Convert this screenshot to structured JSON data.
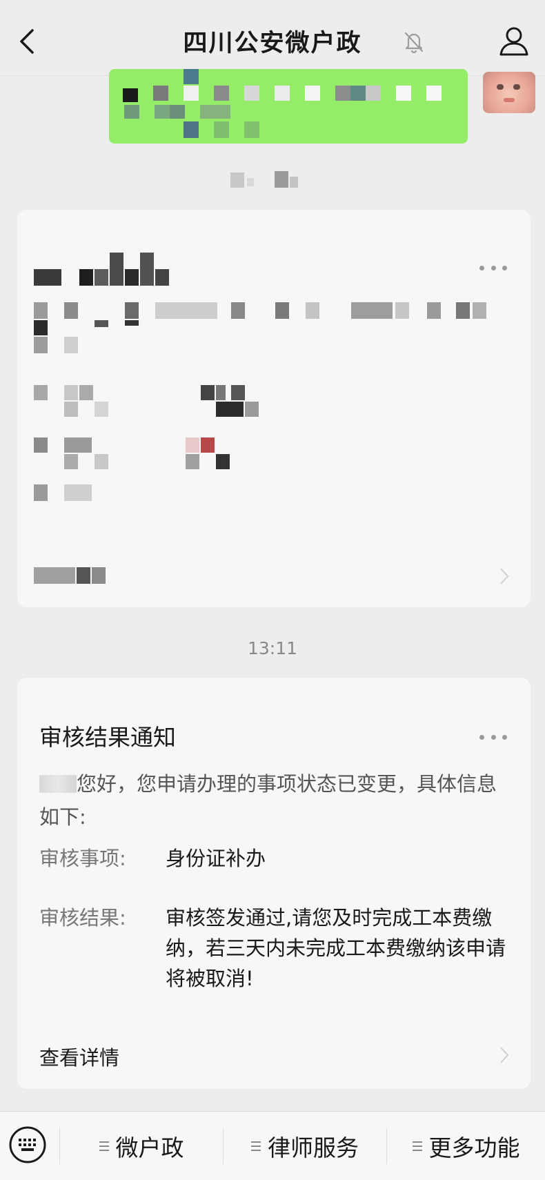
{
  "header": {
    "title": "四川公安微户政"
  },
  "timestamp": "13:11",
  "notice": {
    "title": "审核结果通知",
    "greeting": "您好，您申请办理的事项状态已变更，具体信息如下:",
    "fields": [
      {
        "label": "审核事项:",
        "value": "身份证补办"
      },
      {
        "label": "审核结果:",
        "value": "审核签发通过,请您及时完成工本费缴纳，若三天内未完成工本费缴纳该申请将被取消!"
      }
    ],
    "detail_link": "查看详情"
  },
  "bottom_menu": {
    "items": [
      {
        "label": "微户政"
      },
      {
        "label": "律师服务"
      },
      {
        "label": "更多功能"
      }
    ]
  },
  "colors": {
    "background": "#ededed",
    "card": "#f7f7f7",
    "bubble": "#95ec69",
    "muted_text": "#777777"
  }
}
